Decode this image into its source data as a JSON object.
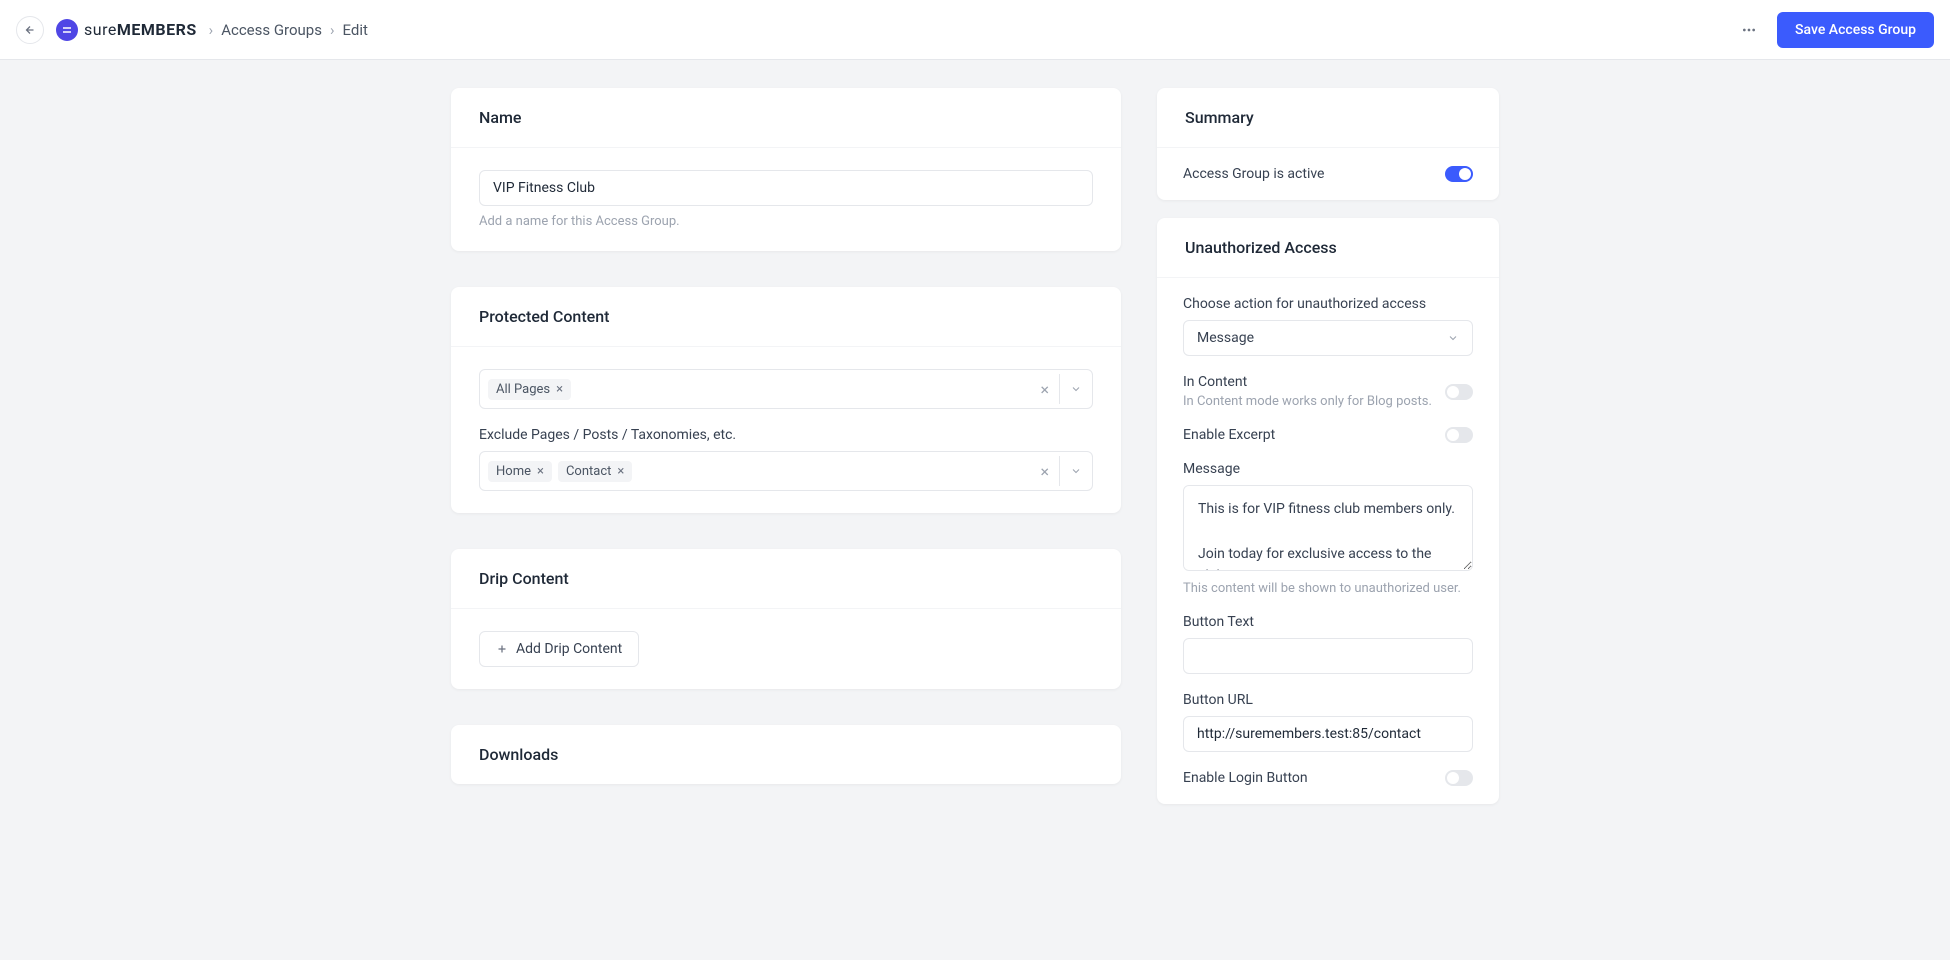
{
  "header": {
    "logo_sure": "sure",
    "logo_members": "MEMBERS",
    "breadcrumb1": "Access Groups",
    "breadcrumb2": "Edit",
    "save_label": "Save Access Group"
  },
  "name_card": {
    "title": "Name",
    "value": "VIP Fitness Club",
    "helper": "Add a name for this Access Group."
  },
  "protected_card": {
    "title": "Protected Content",
    "include_tags": [
      "All Pages"
    ],
    "exclude_label": "Exclude Pages / Posts / Taxonomies, etc.",
    "exclude_tags": [
      "Home",
      "Contact"
    ]
  },
  "drip_card": {
    "title": "Drip Content",
    "add_label": "Add Drip Content"
  },
  "downloads_card": {
    "title": "Downloads"
  },
  "summary_card": {
    "title": "Summary",
    "active_label": "Access Group is active"
  },
  "unauthorized_card": {
    "title": "Unauthorized Access",
    "action_label": "Choose action for unauthorized access",
    "action_value": "Message",
    "in_content_label": "In Content",
    "in_content_desc": "In Content mode works only for Blog posts.",
    "excerpt_label": "Enable Excerpt",
    "message_label": "Message",
    "message_value": "This is for VIP fitness club members only.\n\nJoin today for exclusive access to the club!",
    "message_helper": "This content will be shown to unauthorized user.",
    "button_text_label": "Button Text",
    "button_text_value": "",
    "button_url_label": "Button URL",
    "button_url_value": "http://suremembers.test:85/contact",
    "login_btn_label": "Enable Login Button"
  }
}
